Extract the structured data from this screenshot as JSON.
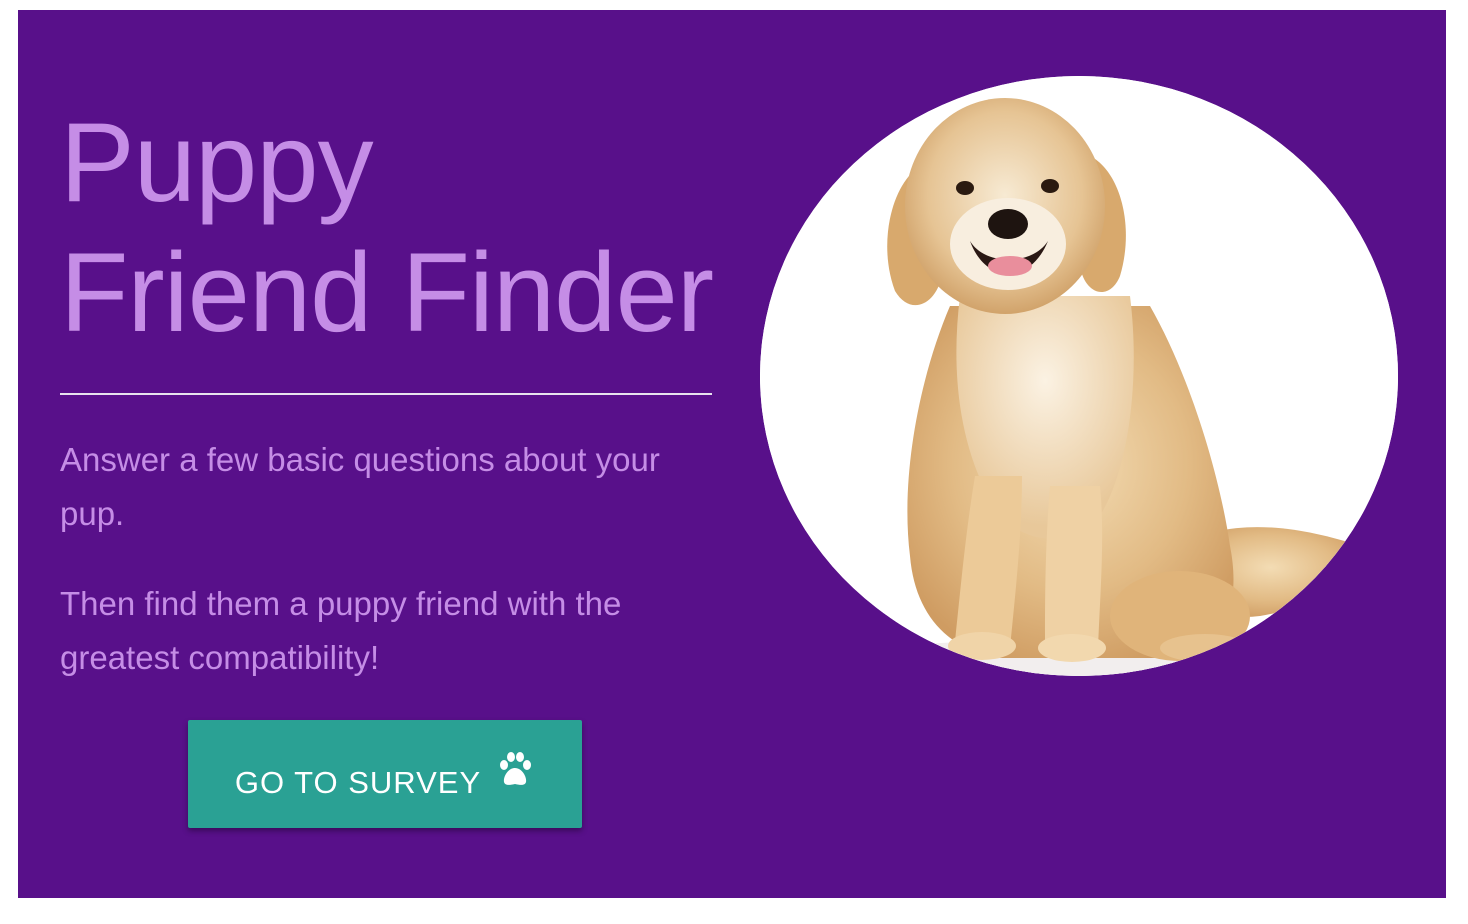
{
  "hero": {
    "title_line1": "Puppy",
    "title_line2": "Friend Finder",
    "paragraph1": "Answer a few basic questions about your pup.",
    "paragraph2": "Then find them a puppy friend with the greatest compatibility!",
    "button_label": "GO TO SURVEY",
    "button_icon": "paw-icon",
    "image_subject": "golden retriever"
  },
  "colors": {
    "background": "#58108a",
    "title_text": "#c58de6",
    "button": "#2aa194",
    "button_text": "#ffffff"
  }
}
